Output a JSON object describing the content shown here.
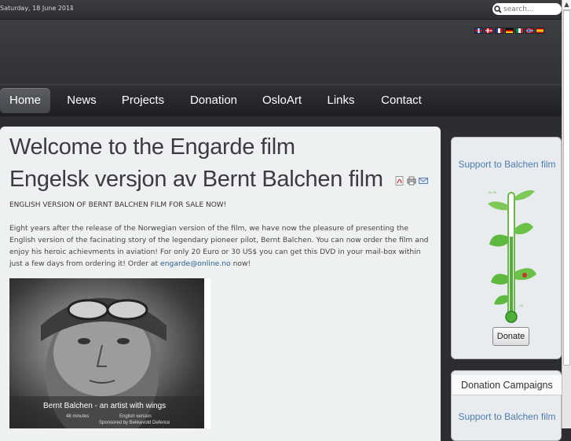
{
  "top": {
    "date": "Saturday, 18 June 2011",
    "search_placeholder": "search..."
  },
  "flags": [
    "gb",
    "dk",
    "fr",
    "de",
    "it",
    "no",
    "es"
  ],
  "nav": {
    "items": [
      "Home",
      "News",
      "Projects",
      "Donation",
      "OsloArt",
      "Links",
      "Contact"
    ],
    "active": "Home"
  },
  "article": {
    "title1": "Welcome to the Engarde film",
    "title2": "Engelsk versjon av Bernt Balchen film",
    "headline": "ENGLISH VERSION OF BERNT BALCHEN FILM FOR SALE NOW!",
    "body": "Eight years after the release of the Norwegian version of the film, we have now the pleasure of presenting the English version of the facinating story of the legendary pioneer pilot, Bernt Balchen.  You can now order the film and enjoy his heroic achievments in aviation! For only 20 Euro or 30 US$ you can get this DVD in your mail-box within just a few days from ordering it! Order at",
    "email": "engarde@online.no",
    "body_end": "now!",
    "photo_caption": "Bernt Balchen - an artist with wings",
    "photo_minutes": "48 minutes",
    "photo_lang": "English version",
    "photo_sponsor": "Sponsored by Bekkevold Defence"
  },
  "sidebar": {
    "box1_title": "Support to Balchen film",
    "donate_label": "Donate",
    "box2_head": "Donation Campaigns",
    "box2_title": "Support to Balchen film"
  },
  "icons": {
    "search": "search-icon",
    "pdf": "pdf-icon",
    "print": "print-icon",
    "email": "email-icon"
  }
}
